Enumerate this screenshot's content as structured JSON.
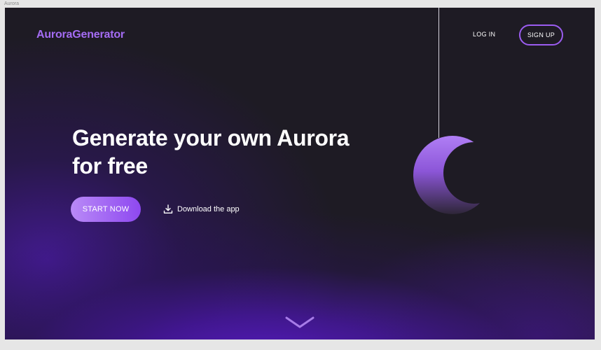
{
  "window": {
    "frame_label": "Aurora"
  },
  "header": {
    "logo": "AuroraGenerator",
    "login_label": "LOG IN",
    "signup_label": "SIGN UP"
  },
  "hero": {
    "headline_line1": "Generate your own Aurora",
    "headline_line2": "for free",
    "start_label": "START NOW",
    "download_label": "Download the app",
    "download_icon": "download-icon",
    "moon_icon": "crescent-moon-icon",
    "scroll_icon": "chevron-down-icon"
  },
  "colors": {
    "background": "#1e1b24",
    "accent": "#9b5cf0",
    "logo": "#a46cf3",
    "glow": "#5e1cd4"
  }
}
